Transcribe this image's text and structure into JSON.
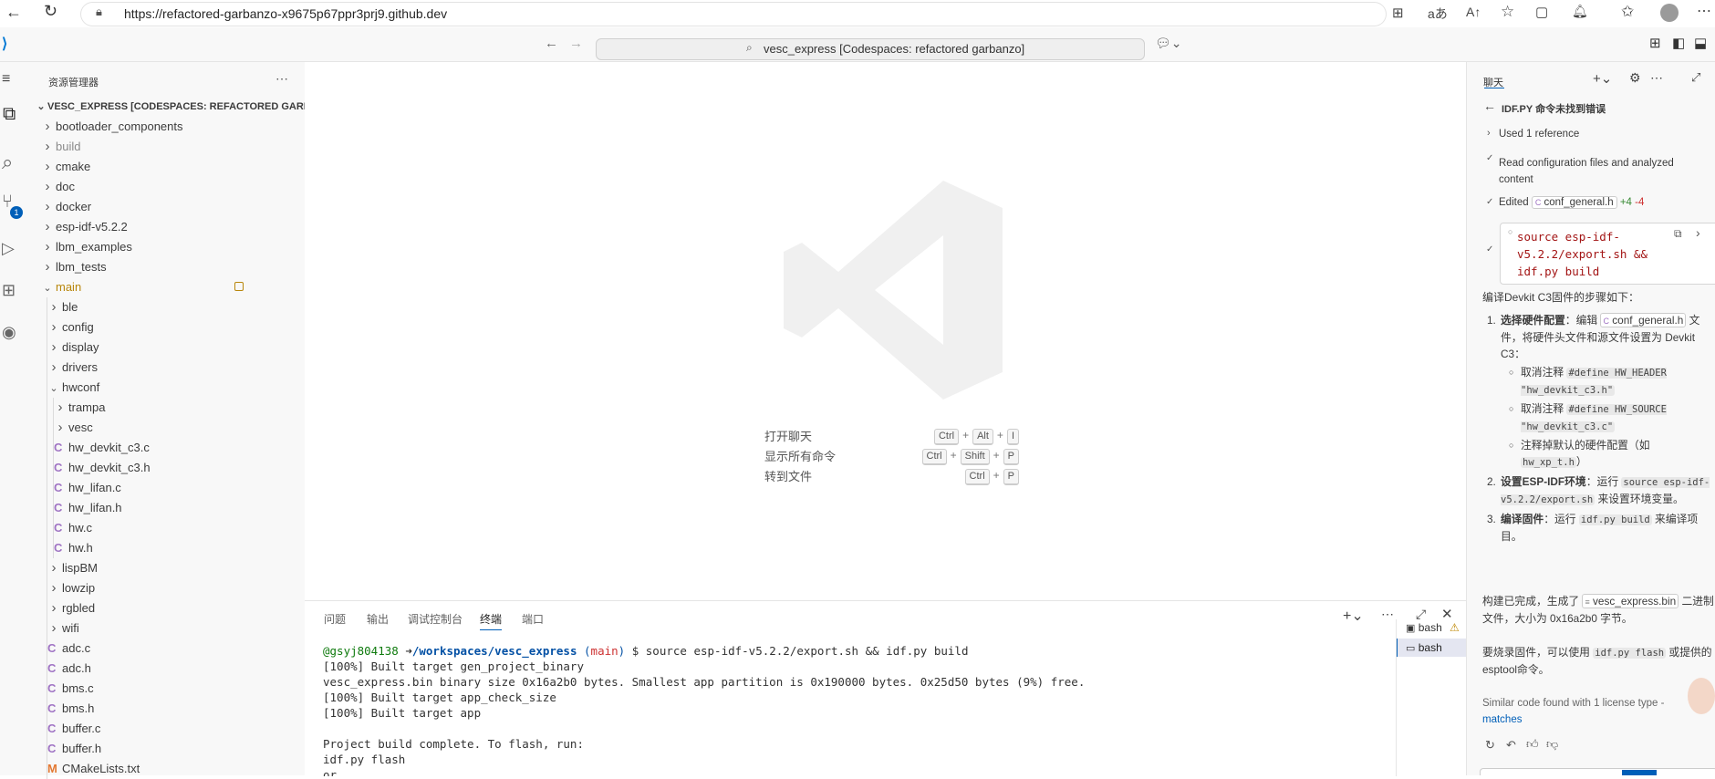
{
  "browser": {
    "url": "https://refactored-garbanzo-x9675p67ppr3prj9.github.dev"
  },
  "vscode": {
    "command_center": "vesc_express [Codespaces: refactored garbanzo]",
    "source_control_badge": "1"
  },
  "explorer": {
    "title": "资源管理器",
    "root": "VESC_EXPRESS [CODESPACES: REFACTORED GARBA...",
    "items": [
      {
        "label": "bootloader_components",
        "type": "folder",
        "level": 0
      },
      {
        "label": "build",
        "type": "folder",
        "level": 0,
        "dim": true
      },
      {
        "label": "cmake",
        "type": "folder",
        "level": 0
      },
      {
        "label": "doc",
        "type": "folder",
        "level": 0
      },
      {
        "label": "docker",
        "type": "folder",
        "level": 0
      },
      {
        "label": "esp-idf-v5.2.2",
        "type": "folder",
        "level": 0
      },
      {
        "label": "lbm_examples",
        "type": "folder",
        "level": 0
      },
      {
        "label": "lbm_tests",
        "type": "folder",
        "level": 0
      },
      {
        "label": "main",
        "type": "folder-open",
        "level": 0,
        "accent": true
      },
      {
        "label": "ble",
        "type": "folder",
        "level": 1
      },
      {
        "label": "config",
        "type": "folder",
        "level": 1
      },
      {
        "label": "display",
        "type": "folder",
        "level": 1
      },
      {
        "label": "drivers",
        "type": "folder",
        "level": 1
      },
      {
        "label": "hwconf",
        "type": "folder-open",
        "level": 1
      },
      {
        "label": "trampa",
        "type": "folder",
        "level": 2
      },
      {
        "label": "vesc",
        "type": "folder",
        "level": 2
      },
      {
        "label": "hw_devkit_c3.c",
        "type": "c",
        "level": 2
      },
      {
        "label": "hw_devkit_c3.h",
        "type": "c",
        "level": 2
      },
      {
        "label": "hw_lifan.c",
        "type": "c",
        "level": 2
      },
      {
        "label": "hw_lifan.h",
        "type": "c",
        "level": 2
      },
      {
        "label": "hw.c",
        "type": "c",
        "level": 2
      },
      {
        "label": "hw.h",
        "type": "c",
        "level": 2
      },
      {
        "label": "lispBM",
        "type": "folder",
        "level": 1
      },
      {
        "label": "lowzip",
        "type": "folder",
        "level": 1
      },
      {
        "label": "rgbled",
        "type": "folder",
        "level": 1
      },
      {
        "label": "wifi",
        "type": "folder",
        "level": 1
      },
      {
        "label": "adc.c",
        "type": "c",
        "level": 1
      },
      {
        "label": "adc.h",
        "type": "c",
        "level": 1
      },
      {
        "label": "bms.c",
        "type": "c",
        "level": 1
      },
      {
        "label": "bms.h",
        "type": "c",
        "level": 1
      },
      {
        "label": "buffer.c",
        "type": "c",
        "level": 1
      },
      {
        "label": "buffer.h",
        "type": "c",
        "level": 1
      },
      {
        "label": "CMakeLists.txt",
        "type": "m",
        "level": 1
      }
    ]
  },
  "welcome": {
    "shortcuts": [
      {
        "label": "打开聊天",
        "keys": [
          "Ctrl",
          "Alt",
          "I"
        ]
      },
      {
        "label": "显示所有命令",
        "keys": [
          "Ctrl",
          "Shift",
          "P"
        ]
      },
      {
        "label": "转到文件",
        "keys": [
          "Ctrl",
          "P"
        ]
      }
    ]
  },
  "panel": {
    "tabs": [
      "问题",
      "输出",
      "调试控制台",
      "终端",
      "端口"
    ],
    "active_tab": "终端",
    "prompt_user": "@gsyj804138",
    "prompt_arrow": "➜",
    "prompt_path": "/workspaces/vesc_express",
    "prompt_branch_open": "(",
    "prompt_branch": "main",
    "prompt_branch_close": ")",
    "prompt_dollar": "$",
    "prompt_cmd": "source esp-idf-v5.2.2/export.sh && idf.py build",
    "lines": [
      "[100%] Built target gen_project_binary",
      "vesc_express.bin binary size 0x16a2b0 bytes. Smallest app partition is 0x190000 bytes. 0x25d50 bytes (9%) free.",
      "[100%] Built target app_check_size",
      "[100%] Built target app",
      "",
      "Project build complete. To flash, run:",
      " idf.py flash",
      "or"
    ],
    "terminals": [
      "bash",
      "bash"
    ]
  },
  "chat": {
    "title": "聊天",
    "thread_title": "IDF.PY 命令未找到错误",
    "used_ref": "Used 1 reference",
    "read_cfg": "Read configuration files and analyzed content",
    "edited_label": "Edited",
    "edited_file": "conf_general.h",
    "edited_add": "+4",
    "edited_del": "-4",
    "cmd_code": "source esp-idf-v5.2.2/export.sh && idf.py build",
    "intro": "编译Devkit C3固件的步骤如下：",
    "step1_title": "选择硬件配置",
    "step1_a": "：编辑",
    "step1_file": "conf_general.h",
    "step1_b": "文件，将硬件头文件和源文件设置为 Devkit C3：",
    "bul1_pre": "取消注释",
    "bul1_code": "#define HW_HEADER \"hw_devkit_c3.h\"",
    "bul2_pre": "取消注释",
    "bul2_code": "#define HW_SOURCE \"hw_devkit_c3.c\"",
    "bul3_pre": "注释掉默认的硬件配置（如",
    "bul3_code": "hw_xp_t.h",
    "bul3_post": "）",
    "step2_title": "设置ESP-IDF环境",
    "step2_a": "：运行",
    "step2_code": "source esp-idf-v5.2.2/export.sh",
    "step2_b": "来设置环境变量。",
    "step3_title": "编译固件",
    "step3_a": "：运行",
    "step3_code": "idf.py build",
    "step3_b": "来编译项目。",
    "done_a": "构建已完成，生成了",
    "done_file": "vesc_express.bin",
    "done_b": "二进制文件，大小为 0x16a2b0 字节。",
    "flash_a": "要烧录固件，可以使用",
    "flash_code": "idf.py flash",
    "flash_b": "或提供的esptool命令。",
    "similar": "Similar code found with 1 license type -",
    "matches": "matches"
  },
  "colors": {
    "accent": "#005fb8",
    "folder_main": "#b8860b",
    "c_file": "#a074c4"
  }
}
